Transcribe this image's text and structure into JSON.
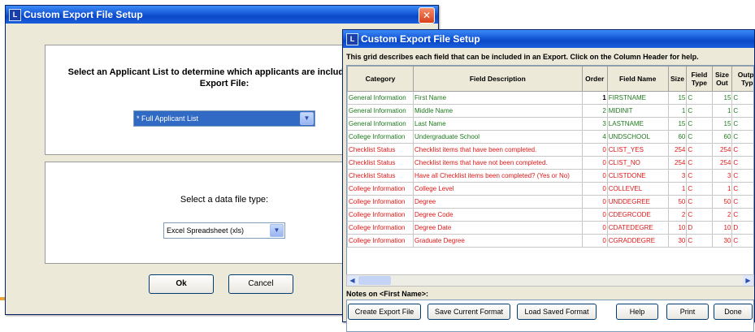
{
  "window1": {
    "title": "Custom Export File Setup",
    "applicant_prompt": "Select an Applicant List to determine which applicants are included in the Export File:",
    "applicant_list_value": "* Full Applicant List",
    "file_type_prompt": "Select a data file type:",
    "file_type_value": "Excel Spreadsheet (xls)",
    "ok_label": "Ok",
    "cancel_label": "Cancel"
  },
  "window2": {
    "title": "Custom Export File Setup",
    "caption": "This grid describes each field that can be included in an Export.  Click on the Column Header for help.",
    "columns": [
      "Category",
      "Field Description",
      "Order",
      "Field Name",
      "Size",
      "Field Type",
      "Size Out",
      "Output Type"
    ],
    "rows": [
      {
        "category": "General Information",
        "desc": "First Name",
        "order": "1",
        "field": "FIRSTNAME",
        "size": "15",
        "type": "C",
        "sizeout": "15",
        "out": "C",
        "color": "green"
      },
      {
        "category": "General Information",
        "desc": "Middle Name",
        "order": "2",
        "field": "MIDINIT",
        "size": "1",
        "type": "C",
        "sizeout": "1",
        "out": "C",
        "color": "green"
      },
      {
        "category": "General Information",
        "desc": "Last Name",
        "order": "3",
        "field": "LASTNAME",
        "size": "15",
        "type": "C",
        "sizeout": "15",
        "out": "C",
        "color": "green"
      },
      {
        "category": "College Information",
        "desc": "Undergraduate School",
        "order": "4",
        "field": "UNDSCHOOL",
        "size": "60",
        "type": "C",
        "sizeout": "60",
        "out": "C",
        "color": "green"
      },
      {
        "category": "Checklist Status",
        "desc": "Checklist items that have been completed.",
        "order": "0",
        "field": "CLIST_YES",
        "size": "254",
        "type": "C",
        "sizeout": "254",
        "out": "C",
        "color": "red"
      },
      {
        "category": "Checklist Status",
        "desc": "Checklist items that have not been completed.",
        "order": "0",
        "field": "CLIST_NO",
        "size": "254",
        "type": "C",
        "sizeout": "254",
        "out": "C",
        "color": "red"
      },
      {
        "category": "Checklist Status",
        "desc": "Have all Checklist items been completed? (Yes or No)",
        "order": "0",
        "field": "CLISTDONE",
        "size": "3",
        "type": "C",
        "sizeout": "3",
        "out": "C",
        "color": "red"
      },
      {
        "category": "College Information",
        "desc": "College Level",
        "order": "0",
        "field": "COLLEVEL",
        "size": "1",
        "type": "C",
        "sizeout": "1",
        "out": "C",
        "color": "red"
      },
      {
        "category": "College Information",
        "desc": "Degree",
        "order": "0",
        "field": "UNDDEGREE",
        "size": "50",
        "type": "C",
        "sizeout": "50",
        "out": "C",
        "color": "red"
      },
      {
        "category": "College Information",
        "desc": "Degree Code",
        "order": "0",
        "field": "CDEGRCODE",
        "size": "2",
        "type": "C",
        "sizeout": "2",
        "out": "C",
        "color": "red"
      },
      {
        "category": "College Information",
        "desc": "Degree Date",
        "order": "0",
        "field": "CDATEDEGRE",
        "size": "10",
        "type": "D",
        "sizeout": "10",
        "out": "D",
        "color": "red"
      },
      {
        "category": "College Information",
        "desc": "Graduate Degree",
        "order": "0",
        "field": "CGRADDEGRE",
        "size": "30",
        "type": "C",
        "sizeout": "30",
        "out": "C",
        "color": "red"
      }
    ],
    "notes_label": "Notes on <First Name>:",
    "buttons": [
      "Create Export File",
      "Save Current Format",
      "Load Saved Format",
      "Help",
      "Print",
      "Done"
    ]
  },
  "colors": {
    "titlebar": "#0a48c8",
    "green_text": "#1f7a1f",
    "red_text": "#e01818",
    "accent_line": "#e8a23a"
  },
  "icons": {
    "app": "app-icon",
    "close": "close-icon",
    "dropdown": "chevron-down-icon"
  }
}
